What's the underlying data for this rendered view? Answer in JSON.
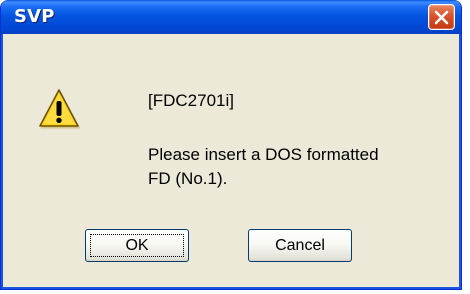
{
  "window": {
    "title": "SVP"
  },
  "message": {
    "code": "[FDC2701i]",
    "line1": "Please insert a DOS formatted",
    "line2": "FD (No.1)."
  },
  "buttons": {
    "ok_label": "OK",
    "cancel_label": "Cancel"
  },
  "icons": {
    "title_close": "close-icon",
    "message": "warning-icon"
  },
  "colors": {
    "titlebar": "#0455e0",
    "close_button": "#d8532b",
    "dialog_background": "#ece9d8",
    "warning_fill": "#ffd21a"
  }
}
